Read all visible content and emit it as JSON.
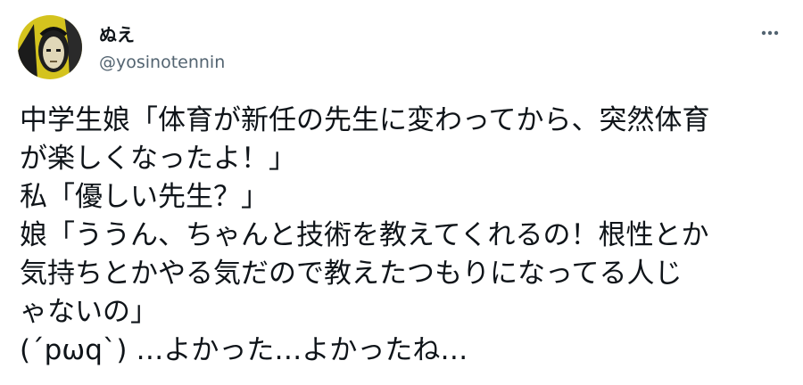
{
  "user": {
    "display_name": "ぬえ",
    "handle": "@yosinotennin"
  },
  "menu": {
    "icon": "more-horizontal-icon"
  },
  "tweet": {
    "lines": [
      "中学生娘「体育が新任の先生に変わってから、突然体育",
      "が楽しくなったよ！」",
      "私「優しい先生？」",
      "娘「ううん、ちゃんと技術を教えてくれるの！根性とか",
      "気持ちとかやる気だので教えたつもりになってる人じ",
      "ゃないの」",
      "(´pωq`) …よかった…よかったね…"
    ]
  },
  "colors": {
    "text": "#0f1419",
    "secondary": "#536471",
    "avatar_background": "#d4c31e"
  }
}
